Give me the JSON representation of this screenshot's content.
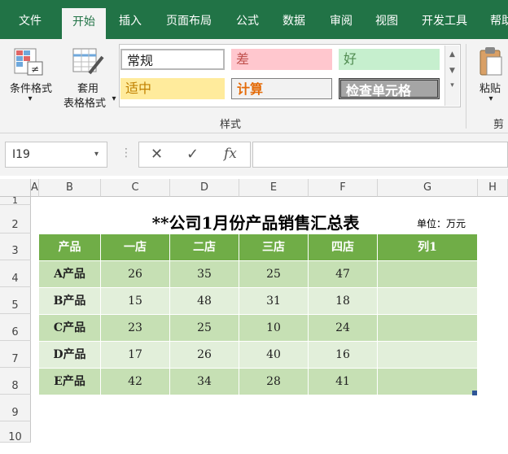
{
  "ribbon": {
    "tabs": [
      "文件",
      "开始",
      "插入",
      "页面布局",
      "公式",
      "数据",
      "审阅",
      "视图",
      "开发工具",
      "帮助"
    ],
    "active_tab": "开始",
    "conditional_format_label": "条件格式",
    "table_format_label_1": "套用",
    "table_format_label_2": "表格格式",
    "styles_group_label": "样式",
    "paste_label": "粘贴",
    "clipboard_label_partial": "剪",
    "styles": {
      "normal": "常规",
      "bad": "差",
      "good": "好",
      "neutral": "适中",
      "calculation": "计算",
      "check_cell": "检查单元格"
    }
  },
  "formula_bar": {
    "name_box": "I19",
    "formula": ""
  },
  "sheet": {
    "columns": [
      "A",
      "B",
      "C",
      "D",
      "E",
      "F",
      "G",
      "H"
    ],
    "rows": [
      "1",
      "2",
      "3",
      "4",
      "5",
      "6",
      "7",
      "8",
      "9",
      "10"
    ],
    "title": "**公司1月份产品销售汇总表",
    "unit": "单位：万元",
    "table_headers": [
      "产品",
      "一店",
      "二店",
      "三店",
      "四店",
      "列1"
    ],
    "table_rows": [
      [
        "A产品",
        "26",
        "35",
        "25",
        "47",
        ""
      ],
      [
        "B产品",
        "15",
        "48",
        "31",
        "18",
        ""
      ],
      [
        "C产品",
        "23",
        "25",
        "10",
        "24",
        ""
      ],
      [
        "D产品",
        "17",
        "26",
        "40",
        "16",
        ""
      ],
      [
        "E产品",
        "42",
        "34",
        "28",
        "41",
        ""
      ]
    ]
  },
  "colors": {
    "excel_green": "#217346",
    "table_header": "#70ad47",
    "band_dark": "#c6e0b4",
    "band_light": "#e2efda"
  }
}
